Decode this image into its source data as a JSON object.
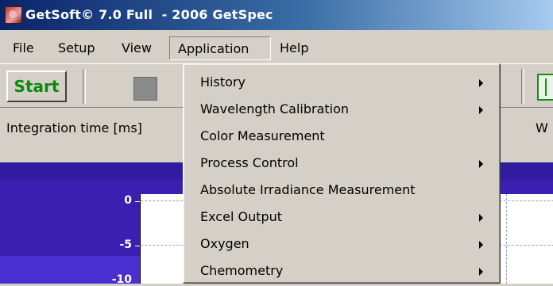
{
  "window": {
    "title": "GetSoft© 7.0 Full  - 2006 GetSpec",
    "app_icon": "getsoft-app-icon"
  },
  "menubar": {
    "items": [
      {
        "label": "File"
      },
      {
        "label": "Setup"
      },
      {
        "label": "View"
      },
      {
        "label": "Application",
        "open": true
      },
      {
        "label": "Help"
      }
    ]
  },
  "toolbar": {
    "start_label": "Start",
    "start_color": "#0a8a0a"
  },
  "params": {
    "integration_label": "Integration time [ms]",
    "right_label": "W"
  },
  "graph": {
    "y_ticks": [
      "0",
      "-5",
      "-10"
    ],
    "background": "#3a1fb0"
  },
  "application_menu": {
    "items": [
      {
        "label": "History",
        "has_submenu": true
      },
      {
        "label": "Wavelength Calibration",
        "has_submenu": true
      },
      {
        "label": "Color Measurement",
        "has_submenu": false
      },
      {
        "label": "Process Control",
        "has_submenu": true
      },
      {
        "label": "Absolute Irradiance Measurement",
        "has_submenu": false
      },
      {
        "label": "Excel Output",
        "has_submenu": true
      },
      {
        "label": "Oxygen",
        "has_submenu": true
      },
      {
        "label": "Chemometry",
        "has_submenu": true
      }
    ]
  }
}
